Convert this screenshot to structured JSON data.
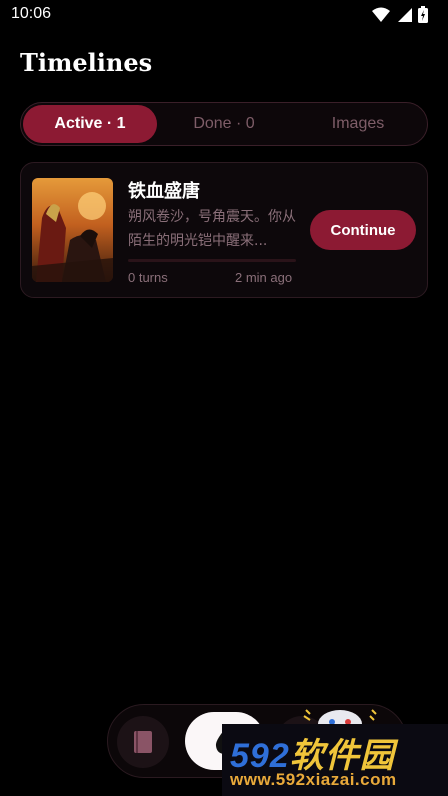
{
  "status_bar": {
    "time": "10:06"
  },
  "page": {
    "title": "Timelines"
  },
  "tabs": [
    {
      "label": "Active · 1",
      "active": true
    },
    {
      "label": "Done · 0",
      "active": false
    },
    {
      "label": "Images",
      "active": false
    }
  ],
  "timeline_card": {
    "title": "铁血盛唐",
    "description": "朔风卷沙，号角震天。你从陌生的明光铠中醒来...",
    "turns": "0 turns",
    "time_ago": "2 min ago",
    "progress": 0.0,
    "button_label": "Continue"
  },
  "bottom_nav": {
    "items": [
      {
        "name": "book",
        "icon": "book-icon"
      },
      {
        "name": "home",
        "icon": "drop-icon"
      },
      {
        "name": "third",
        "icon": "unknown-icon"
      }
    ]
  },
  "watermark": {
    "brand_number": "592",
    "brand_text": "软件园",
    "url": "www.592xiazai.com"
  },
  "colors": {
    "accent": "#8c1a33",
    "muted_text": "#8a6f79",
    "background": "#000000"
  }
}
